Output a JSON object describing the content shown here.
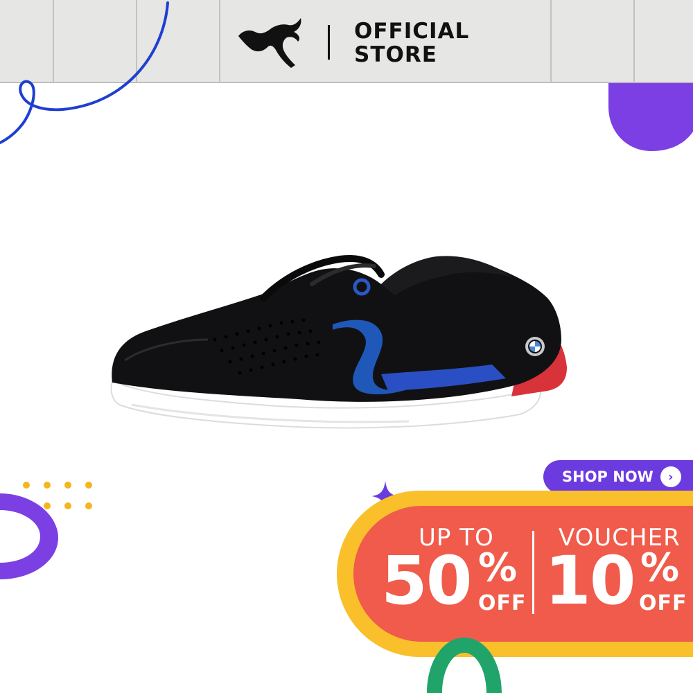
{
  "header": {
    "brand_icon": "puma-cat-logo",
    "store_label_line1": "OFFICIAL",
    "store_label_line2": "STORE"
  },
  "product": {
    "image_icon": "black-sneaker-with-blue-red-stripes",
    "badge_icon": "bmw-roundel-badge"
  },
  "cta": {
    "label": "SHOP NOW",
    "arrow_icon": "chevron-right-icon",
    "arrow_glyph": "›"
  },
  "offer_left": {
    "top_label": "UP TO",
    "value": "50",
    "percent": "%",
    "off": "OFF"
  },
  "offer_right": {
    "top_label": "VOUCHER",
    "value": "10",
    "percent": "%",
    "off": "OFF"
  },
  "colors": {
    "header_bg": "#e6e6e4",
    "purple": "#6b3be0",
    "yellow": "#f9c02c",
    "red": "#f05b4b",
    "green": "#20a46a",
    "blue_line": "#1f3fd1"
  }
}
